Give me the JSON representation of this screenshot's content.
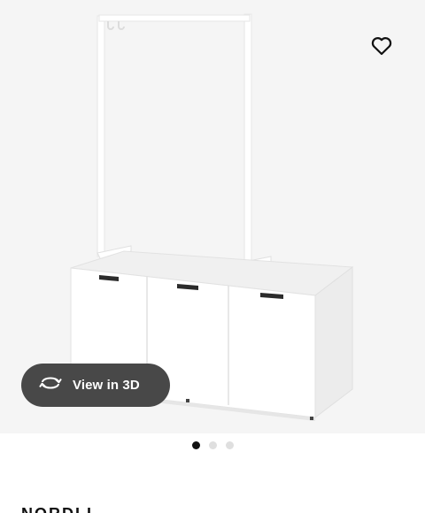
{
  "product": {
    "name": "NORDLI",
    "image_alt": "White chest of 3 drawers with clothes rack"
  },
  "favorite": {
    "icon": "heart-icon"
  },
  "view3d": {
    "label": "View in 3D",
    "icon": "rotate-3d-icon"
  },
  "carousel": {
    "count": 3,
    "active_index": 0
  },
  "colors": {
    "button_bg": "#484848",
    "dot_active": "#111111",
    "dot_inactive": "#dfdfdf",
    "image_bg": "#f5f5f5"
  }
}
